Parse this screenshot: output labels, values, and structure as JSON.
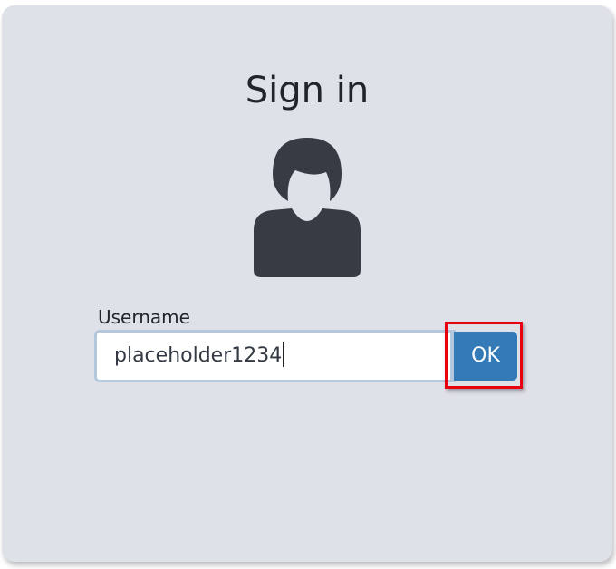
{
  "page": {
    "title": "Sign in"
  },
  "form": {
    "username_label": "Username",
    "username_value": "placeholder1234",
    "submit_label": "OK"
  },
  "icons": {
    "avatar": "user-avatar-icon"
  },
  "colors": {
    "card_background": "#dfe1e8",
    "avatar": "#363b44",
    "button": "#337ab7",
    "highlight": "#e8000f"
  }
}
